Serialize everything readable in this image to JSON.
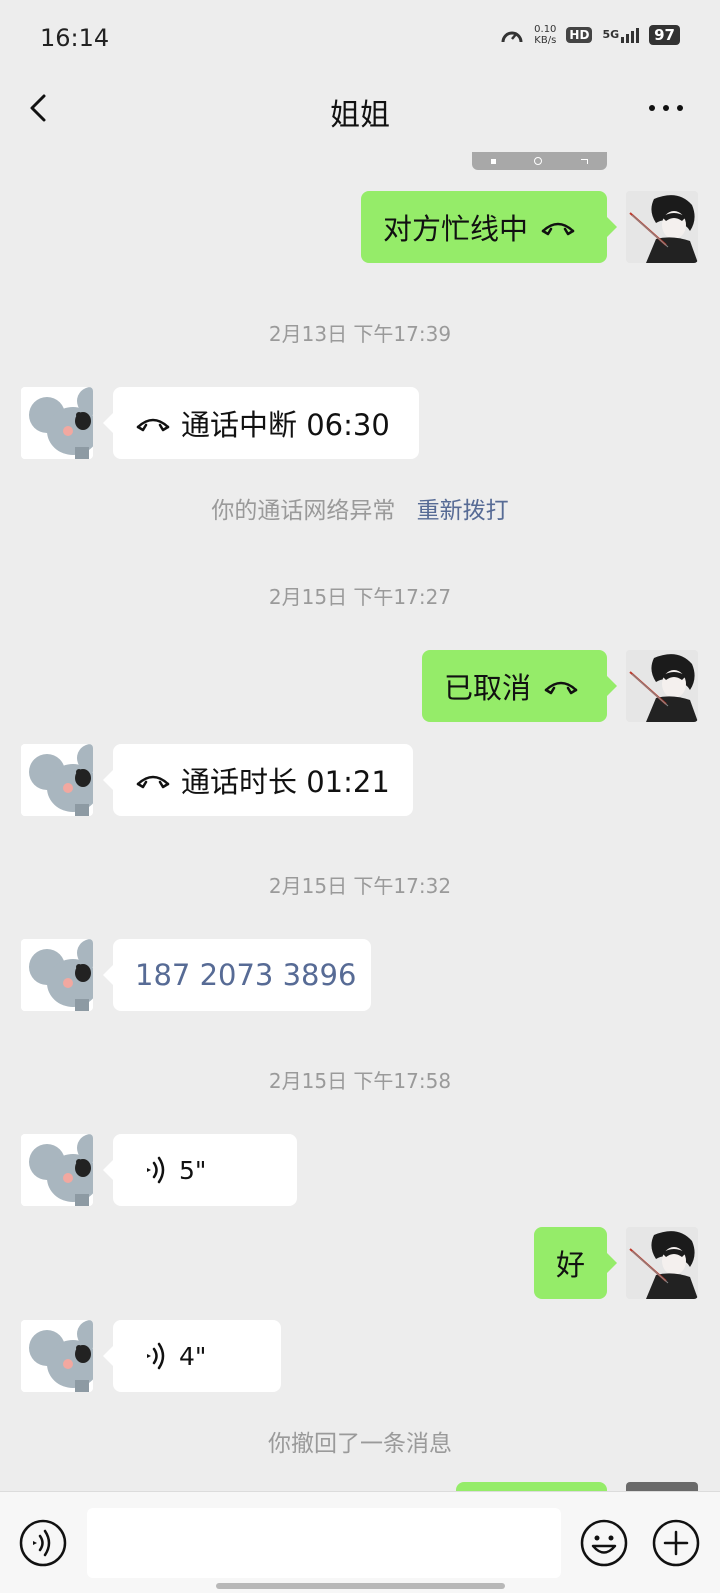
{
  "status": {
    "time": "16:14",
    "speed_value": "0.10",
    "speed_unit": "KB/s",
    "hd": "HD",
    "network": "5G",
    "battery": "97"
  },
  "nav": {
    "title": "姐姐"
  },
  "messages": {
    "m1": {
      "text": "对方忙线中"
    },
    "t1": "2月13日 下午17:39",
    "m2": {
      "text": "通话中断 06:30"
    },
    "note1": {
      "text": "你的通话网络异常",
      "action": "重新拨打"
    },
    "t2": "2月15日 下午17:27",
    "m3": {
      "text": "已取消"
    },
    "m4": {
      "text": "通话时长 01:21"
    },
    "t3": "2月15日 下午17:32",
    "m5": {
      "text": "187 2073 3896"
    },
    "t4": "2月15日 下午17:58",
    "m6": {
      "duration": "5\""
    },
    "m7": {
      "text": "好"
    },
    "m8": {
      "duration": "4\""
    },
    "note2": "你撤回了一条消息"
  },
  "input": {
    "placeholder": ""
  },
  "colors": {
    "background": "#ededed",
    "outgoing_bubble": "#95ec69",
    "incoming_bubble": "#ffffff",
    "link": "#576b95"
  },
  "icons": {
    "call": "phone-hangup-icon",
    "voice": "voice-wave-icon",
    "emoji": "emoji-icon",
    "plus": "plus-icon"
  }
}
